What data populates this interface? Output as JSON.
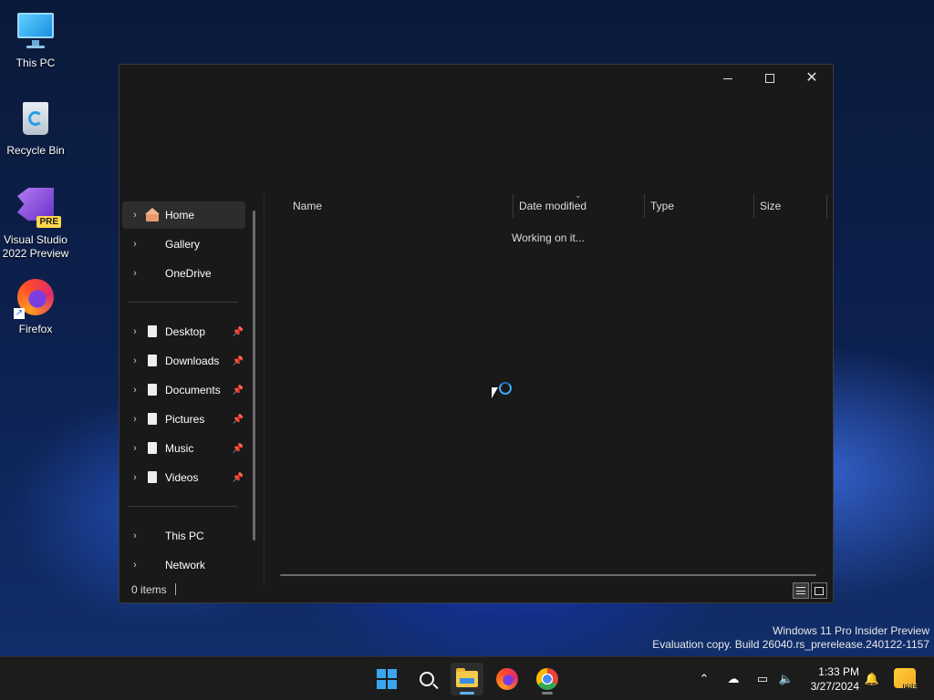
{
  "desktop": {
    "icons": [
      {
        "label": "This PC",
        "icon": "monitor-icon"
      },
      {
        "label": "Recycle Bin",
        "icon": "recycle-bin-icon"
      },
      {
        "label_line1": "Visual Studio",
        "label_line2": "2022 Preview",
        "badge": "PRE",
        "icon": "visual-studio-icon"
      },
      {
        "label": "Firefox",
        "icon": "firefox-icon"
      }
    ]
  },
  "explorer": {
    "nav_items": [
      {
        "label": "Home",
        "icon": "home-icon",
        "selected": true
      },
      {
        "label": "Gallery"
      },
      {
        "label": "OneDrive"
      },
      {
        "label": "Desktop",
        "pinned": true
      },
      {
        "label": "Downloads",
        "pinned": true
      },
      {
        "label": "Documents",
        "pinned": true
      },
      {
        "label": "Pictures",
        "pinned": true
      },
      {
        "label": "Music",
        "pinned": true
      },
      {
        "label": "Videos",
        "pinned": true
      },
      {
        "label": "This PC"
      },
      {
        "label": "Network"
      }
    ],
    "columns": [
      "Name",
      "Date modified",
      "Type",
      "Size"
    ],
    "status_message": "Working on it...",
    "status_bar": {
      "items_count": "0 items"
    }
  },
  "watermark": {
    "line1": "Windows 11 Pro Insider Preview",
    "line2": "Evaluation copy. Build 26040.rs_prerelease.240122-1157"
  },
  "taskbar": {
    "apps": [
      "start-icon",
      "search-icon",
      "file-explorer-icon",
      "firefox-icon",
      "chrome-icon"
    ],
    "active_app": "file-explorer-icon",
    "clock": {
      "time": "1:33 PM",
      "date": "3/27/2024"
    },
    "copilot_badge": "PRE",
    "accent_color": "#3aa6f0"
  }
}
